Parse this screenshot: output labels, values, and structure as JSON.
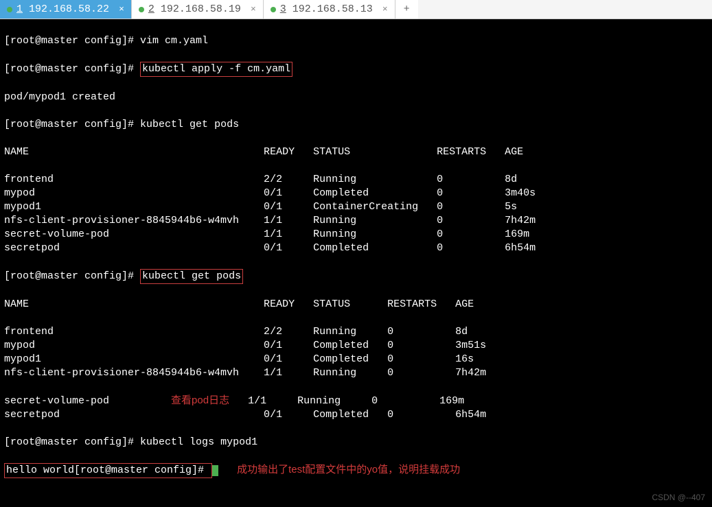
{
  "tabs": [
    {
      "num": "1",
      "ip": "192.168.58.22",
      "active": true
    },
    {
      "num": "2",
      "ip": "192.168.58.19",
      "active": false
    },
    {
      "num": "3",
      "ip": "192.168.58.13",
      "active": false
    }
  ],
  "addTab": "+",
  "prompt": "[root@master config]# ",
  "commands": {
    "vim": "vim cm.yaml",
    "apply": "kubectl apply -f cm.yaml",
    "applyResult": "pod/mypod1 created",
    "getPods": "kubectl get pods",
    "logs": "kubectl logs mypod1",
    "logsOutput": "hello world"
  },
  "headers1": {
    "name": "NAME",
    "ready": "READY",
    "status": "STATUS",
    "restarts": "RESTARTS",
    "age": "AGE"
  },
  "table1": [
    {
      "name": "frontend",
      "ready": "2/2",
      "status": "Running",
      "restarts": "0",
      "age": "8d"
    },
    {
      "name": "mypod",
      "ready": "0/1",
      "status": "Completed",
      "restarts": "0",
      "age": "3m40s"
    },
    {
      "name": "mypod1",
      "ready": "0/1",
      "status": "ContainerCreating",
      "restarts": "0",
      "age": "5s"
    },
    {
      "name": "nfs-client-provisioner-8845944b6-w4mvh",
      "ready": "1/1",
      "status": "Running",
      "restarts": "0",
      "age": "7h42m"
    },
    {
      "name": "secret-volume-pod",
      "ready": "1/1",
      "status": "Running",
      "restarts": "0",
      "age": "169m"
    },
    {
      "name": "secretpod",
      "ready": "0/1",
      "status": "Completed",
      "restarts": "0",
      "age": "6h54m"
    }
  ],
  "headers2": {
    "name": "NAME",
    "ready": "READY",
    "status": "STATUS",
    "restarts": "RESTARTS",
    "age": "AGE"
  },
  "table2": [
    {
      "name": "frontend",
      "ready": "2/2",
      "status": "Running",
      "restarts": "0",
      "age": "8d"
    },
    {
      "name": "mypod",
      "ready": "0/1",
      "status": "Completed",
      "restarts": "0",
      "age": "3m51s"
    },
    {
      "name": "mypod1",
      "ready": "0/1",
      "status": "Completed",
      "restarts": "0",
      "age": "16s"
    },
    {
      "name": "nfs-client-provisioner-8845944b6-w4mvh",
      "ready": "1/1",
      "status": "Running",
      "restarts": "0",
      "age": "7h42m"
    },
    {
      "name": "secret-volume-pod",
      "ready": "1/1",
      "status": "Running",
      "restarts": "0",
      "age": "169m"
    },
    {
      "name": "secretpod",
      "ready": "0/1",
      "status": "Completed",
      "restarts": "0",
      "age": "6h54m"
    }
  ],
  "annotations": {
    "viewLogs": "查看pod日志",
    "success": "成功输出了test配置文件中的yo值，说明挂载成功"
  },
  "watermark": "CSDN @--407"
}
